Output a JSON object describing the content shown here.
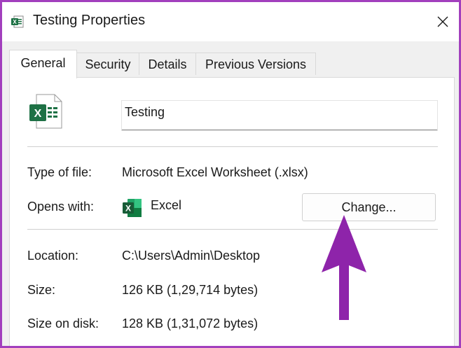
{
  "window": {
    "title": "Testing Properties",
    "icon": "excel-file-icon",
    "close_icon": "close-icon"
  },
  "tabs": [
    {
      "label": "General",
      "active": true
    },
    {
      "label": "Security",
      "active": false
    },
    {
      "label": "Details",
      "active": false
    },
    {
      "label": "Previous Versions",
      "active": false
    }
  ],
  "general": {
    "file_name": "Testing",
    "type_label": "Type of file:",
    "type_value": "Microsoft Excel Worksheet (.xlsx)",
    "opens_label": "Opens with:",
    "opens_value": "Excel",
    "change_label": "Change...",
    "location_label": "Location:",
    "location_value": "C:\\Users\\Admin\\Desktop",
    "size_label": "Size:",
    "size_value": "126 KB (1,29,714 bytes)",
    "size_disk_label": "Size on disk:",
    "size_disk_value": "128 KB (1,31,072 bytes)"
  },
  "colors": {
    "excel_green": "#1e7145",
    "annotation_arrow": "#8e24aa",
    "border": "#a23fbd"
  }
}
